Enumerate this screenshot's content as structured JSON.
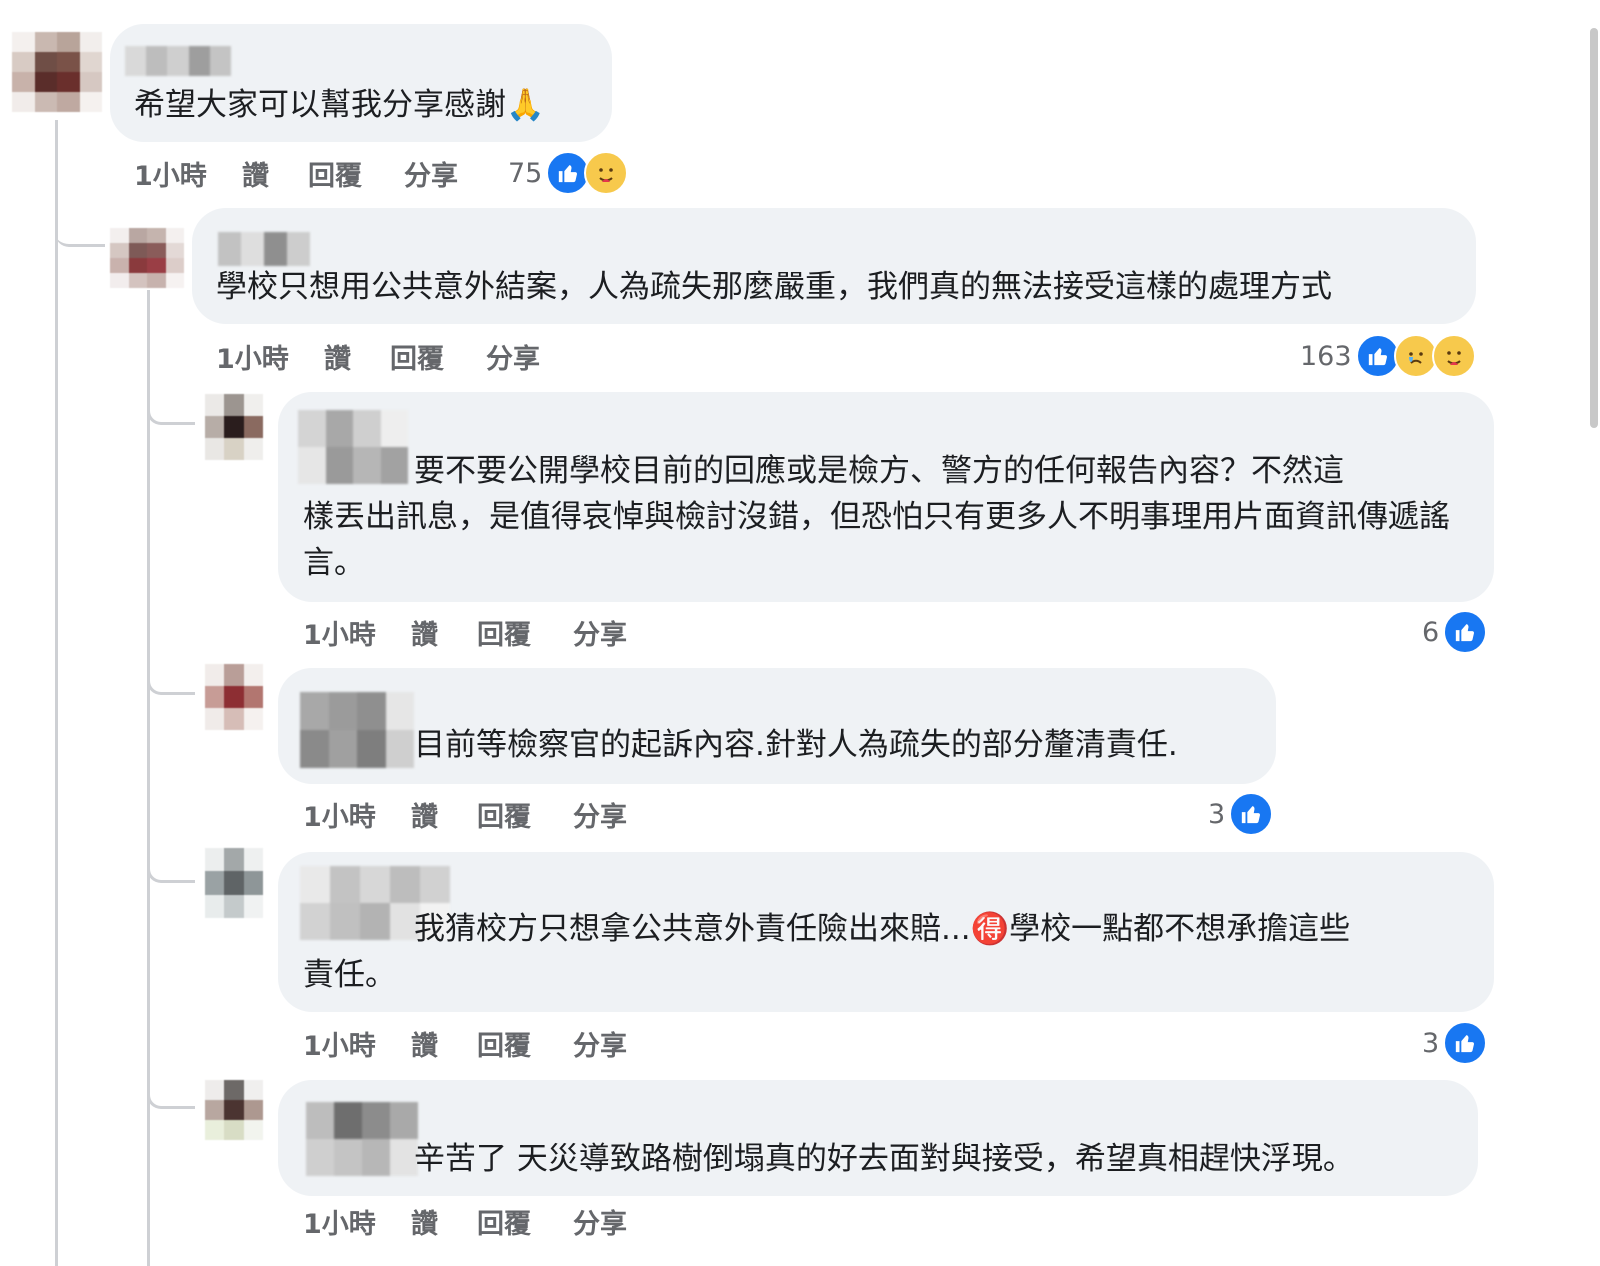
{
  "colors": {
    "bubble": "#eff2f5",
    "like_blue": "#1877f2",
    "meta_gray": "#65676b",
    "thread_line": "#ced0d4"
  },
  "actions": {
    "like": "讚",
    "reply": "回覆",
    "share": "分享"
  },
  "comments": [
    {
      "time": "1小時",
      "text": "希望大家可以幫我分享感謝🙏",
      "reaction_count": "75",
      "reactions": [
        "like-icon",
        "care-icon"
      ]
    },
    {
      "time": "1小時",
      "text": "學校只想用公共意外結案，人為疏失那麼嚴重，我們真的無法接受這樣的處理方式",
      "reaction_count": "163",
      "reactions": [
        "like-icon",
        "sad-icon",
        "care-icon"
      ]
    },
    {
      "time": "1小時",
      "text_line1": "要不要公開學校目前的回應或是檢方、警方的任何報告內容？不然這",
      "text_rest": "樣丟出訊息，是值得哀悼與檢討沒錯，但恐怕只有更多人不明事理用片面資訊傳遞謠言。",
      "reaction_count": "6",
      "reactions": [
        "like-icon"
      ]
    },
    {
      "time": "1小時",
      "text": "目前等檢察官的起訴內容.針對人為疏失的部分釐清責任.",
      "reaction_count": "3",
      "reactions": [
        "like-icon"
      ]
    },
    {
      "time": "1小時",
      "text_line1": "我猜校方只想拿公共意外責任險出來賠...🉐學校一點都不想承擔這些",
      "text_rest": "責任。",
      "reaction_count": "3",
      "reactions": [
        "like-icon"
      ]
    },
    {
      "time": "1小時",
      "text": "辛苦了 天災導致路樹倒塌真的好去面對與接受，希望真相趕快浮現。"
    }
  ]
}
